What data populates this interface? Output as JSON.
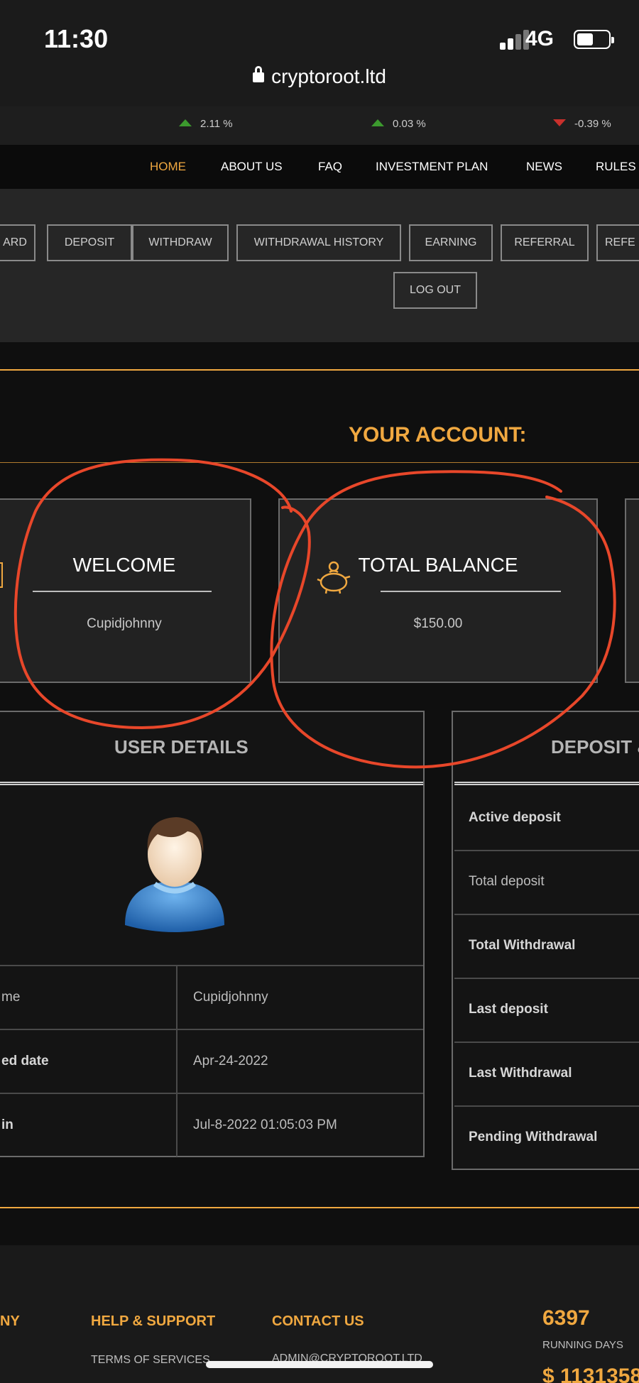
{
  "status": {
    "time": "11:30",
    "network": "4G"
  },
  "browser": {
    "url": "cryptoroot.ltd"
  },
  "ticker": [
    {
      "change": "2.11 %",
      "direction": "up"
    },
    {
      "change": "0.03 %",
      "direction": "up"
    },
    {
      "change": "-0.39 %",
      "direction": "down"
    }
  ],
  "colors": {
    "accent": "#f0a840",
    "up": "#3c9a2e",
    "down": "#c9302c",
    "annotation": "#e8472a"
  },
  "nav": {
    "home": "HOME",
    "about": "ABOUT US",
    "faq": "FAQ",
    "plan": "INVESTMENT PLAN",
    "news": "NEWS",
    "rules": "RULES"
  },
  "account_menu": {
    "dashboard": "ARD",
    "deposit": "DEPOSIT",
    "withdraw": "WITHDRAW",
    "withdrawal_history": "WITHDRAWAL HISTORY",
    "earning": "EARNING",
    "referral": "REFERRAL",
    "referral2": "REFE",
    "logout": "LOG OUT"
  },
  "account": {
    "title": "YOUR ACCOUNT:",
    "welcome_title": "WELCOME",
    "welcome_value": "Cupidjohnny",
    "balance_title": "TOTAL BALANCE",
    "balance_value": "$150.00",
    "balance_icon": "piggy-bank-icon"
  },
  "user_details": {
    "title": "USER DETAILS",
    "avatar_icon": "user-avatar-icon",
    "rows": [
      {
        "label": "me",
        "value": "Cupidjohnny"
      },
      {
        "label": "ed date",
        "value": "Apr-24-2022"
      },
      {
        "label": "in",
        "value": "Jul-8-2022 01:05:03 PM"
      }
    ]
  },
  "deposit_panel": {
    "title": "DEPOSIT &",
    "rows": [
      "Active deposit",
      "Total deposit",
      "Total Withdrawal",
      "Last deposit",
      "Last Withdrawal",
      "Pending Withdrawal"
    ]
  },
  "footer": {
    "company": "NY",
    "help_title": "HELP & SUPPORT",
    "terms": "TERMS OF SERVICES",
    "contact_title": "CONTACT US",
    "email": "ADMIN@CRYPTOROOT.LTD",
    "running_days_value": "6397",
    "running_days_label": "RUNNING DAYS",
    "total_value": "$ 1131358"
  }
}
